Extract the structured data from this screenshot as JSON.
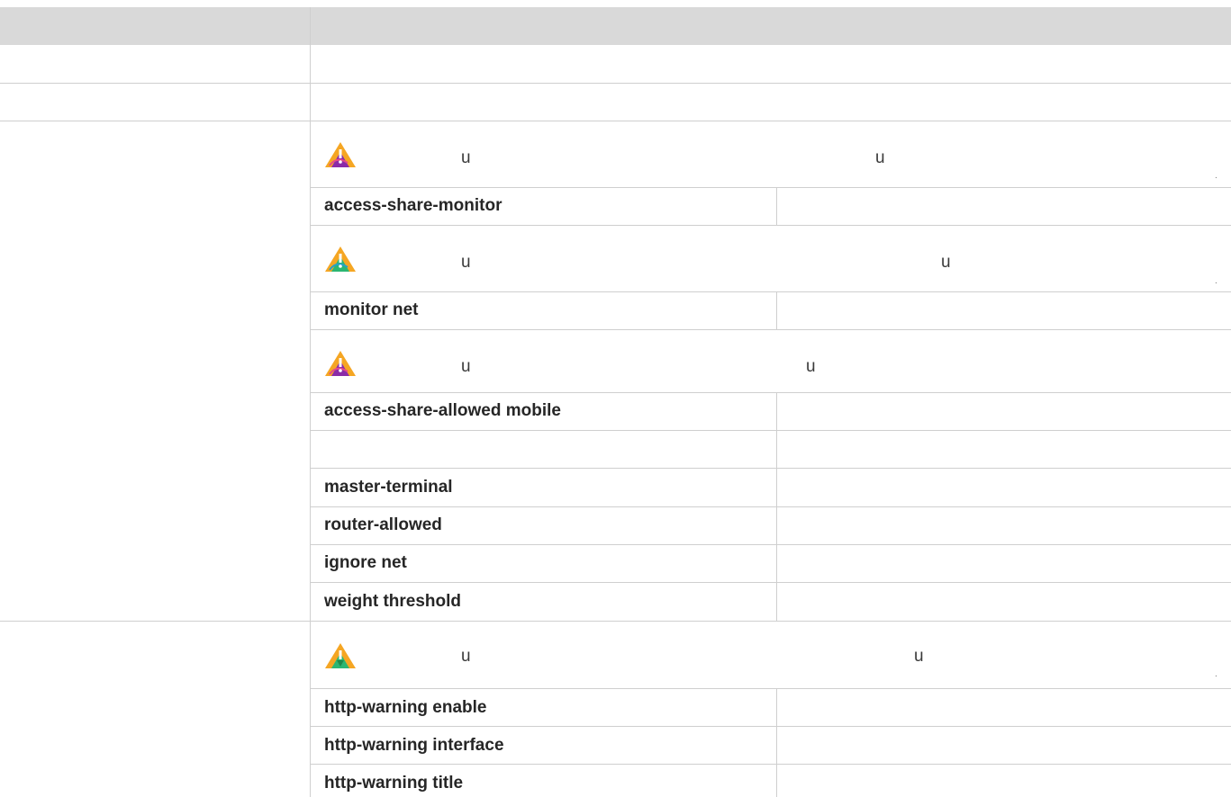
{
  "header": {
    "col1": "",
    "col2": ""
  },
  "commands": {
    "access_share_monitor": "access-share-monitor",
    "monitor_net": "monitor net",
    "access_share_allowed_mobile": "access-share-allowed mobile",
    "master_terminal": "master-terminal",
    "router_allowed": "router-allowed",
    "ignore_net": "ignore net",
    "weight_threshold": "weight threshold",
    "http_warning_enable": "http-warning enable",
    "http_warning_interface": "http-warning interface",
    "http_warning_title": "http-warning title"
  },
  "notes": {
    "char": "u",
    "dot": "."
  },
  "icons": {
    "warning1": "warning-icon",
    "warning2": "warning-icon",
    "warning3": "warning-icon",
    "warning4": "warning-icon"
  },
  "colors": {
    "header_bg": "#d9d9d9",
    "grid": "#cfcfcf",
    "warn_orange": "#f5a623",
    "warn_purple": "#8a2ba8",
    "warn_green": "#2bb673"
  }
}
